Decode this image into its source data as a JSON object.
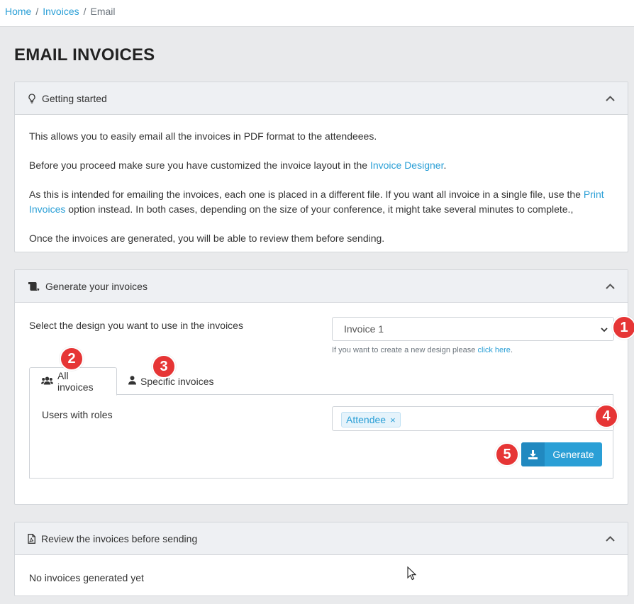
{
  "breadcrumb": {
    "home": "Home",
    "invoices": "Invoices",
    "current": "Email",
    "sep": "/"
  },
  "page_title": "EMAIL INVOICES",
  "getting_started": {
    "title": "Getting started",
    "p1": "This allows you to easily email all the invoices in PDF format to the attendeees.",
    "p2_before": "Before you proceed make sure you have customized the invoice layout in the ",
    "p2_link": "Invoice Designer",
    "p2_after": ".",
    "p3_before": "As this is intended for emailing the invoices, each one is placed in a different file. If you want all invoice in a single file, use the ",
    "p3_link": "Print Invoices",
    "p3_after": " option instead. In both cases, depending on the size of your conference, it might take several minutes to complete.,",
    "p4": "Once the invoices are generated, you will be able to review them before sending."
  },
  "generate": {
    "title": "Generate your invoices",
    "design_label": "Select the design you want to use in the invoices",
    "design_value": "Invoice 1",
    "help_before": "If you want to create a new design please ",
    "help_link": "click here",
    "help_after": ".",
    "tab_all": "All invoices",
    "tab_specific": "Specific invoices",
    "roles_label": "Users with roles",
    "role_tag": "Attendee",
    "role_remove": "×",
    "button": "Generate"
  },
  "review": {
    "title": "Review the invoices before sending",
    "empty": "No invoices generated yet"
  },
  "badges": [
    "1",
    "2",
    "3",
    "4",
    "5"
  ],
  "colors": {
    "accent": "#2a9fd6",
    "badge": "#e63535"
  }
}
